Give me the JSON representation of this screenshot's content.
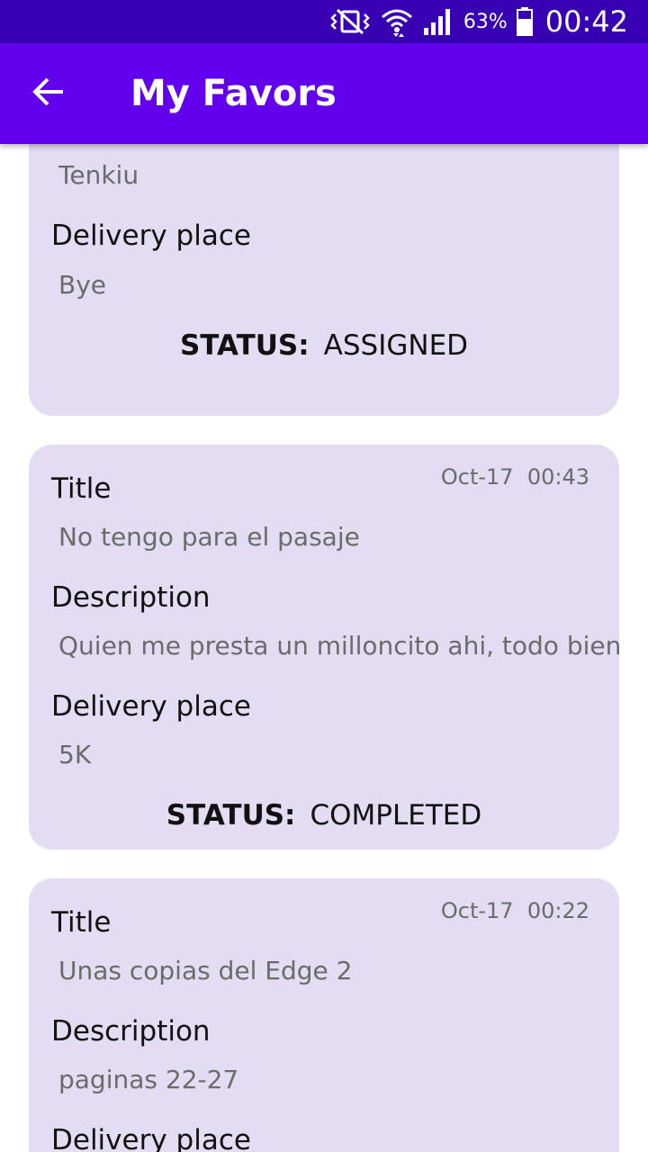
{
  "status_bar": {
    "icons": [
      "vibrate-icon",
      "wifi-icon",
      "signal-icon",
      "battery-icon"
    ],
    "battery_percent": "63%",
    "time": "00:42"
  },
  "app_bar": {
    "back_icon": "arrow-left-icon",
    "title": "My Favors"
  },
  "labels": {
    "title": "Title",
    "description": "Description",
    "delivery_place": "Delivery place",
    "status": "STATUS:"
  },
  "cards": [
    {
      "description": "Tenkiu",
      "delivery_place": "Bye",
      "status": "ASSIGNED"
    },
    {
      "date": "Oct-17",
      "time": "00:43",
      "title": "No tengo para el pasaje",
      "description": "Quien me presta un milloncito ahi, todo bien",
      "delivery_place": "5K",
      "status": "COMPLETED"
    },
    {
      "date": "Oct-17",
      "time": "00:22",
      "title": "Unas copias del Edge 2",
      "description": "paginas 22-27"
    }
  ],
  "colors": {
    "status_bar": "#3700b3",
    "app_bar": "#6200ee",
    "card_background": "#e3dcf2"
  }
}
